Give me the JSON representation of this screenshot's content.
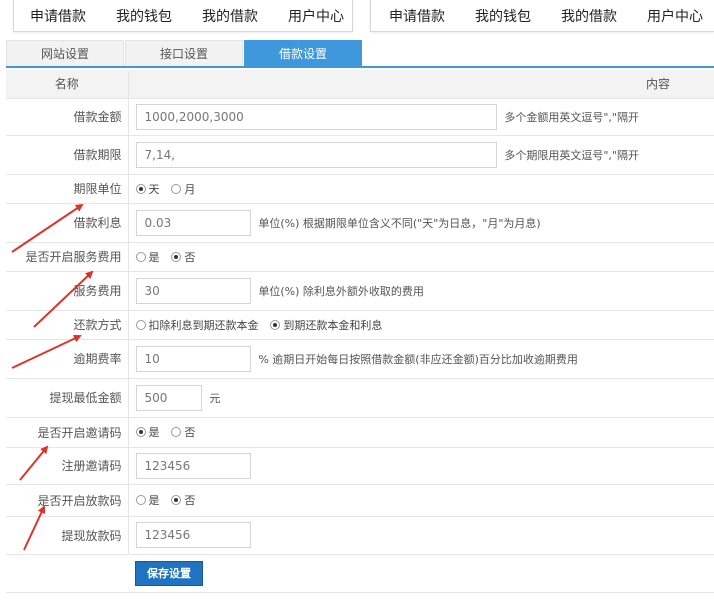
{
  "nav": {
    "left": [
      "申请借款",
      "我的钱包",
      "我的借款",
      "用户中心"
    ],
    "right": [
      "申请借款",
      "我的钱包",
      "我的借款",
      "用户中心"
    ]
  },
  "tabs": [
    {
      "label": "网站设置",
      "active": false
    },
    {
      "label": "接口设置",
      "active": false
    },
    {
      "label": "借款设置",
      "active": true
    }
  ],
  "table_header": {
    "name": "名称",
    "content": "内容"
  },
  "fields": {
    "amount": {
      "label": "借款金额",
      "value": "1000,2000,3000",
      "hint": "多个金额用英文逗号\",\"隔开"
    },
    "term": {
      "label": "借款期限",
      "value": "7,14,",
      "hint": "多个期限用英文逗号\",\"隔开"
    },
    "term_unit": {
      "label": "期限单位",
      "options": [
        "天",
        "月"
      ],
      "selected": 0
    },
    "interest": {
      "label": "借款利息",
      "value": "0.03",
      "hint": "单位(%) 根据期限单位含义不同(\"天\"为日息，\"月\"为月息)"
    },
    "service_fee_enabled": {
      "label": "是否开启服务费用",
      "options": [
        "是",
        "否"
      ],
      "selected": 1
    },
    "service_fee": {
      "label": "服务费用",
      "value": "30",
      "hint": "单位(%) 除利息外额外收取的费用"
    },
    "repayment": {
      "label": "还款方式",
      "options": [
        "扣除利息到期还款本金",
        "到期还款本金和利息"
      ],
      "selected": 1
    },
    "overdue_rate": {
      "label": "逾期费率",
      "value": "10",
      "hint": "% 逾期日开始每日按照借款金额(非应还金额)百分比加收逾期费用"
    },
    "min_withdraw": {
      "label": "提现最低金额",
      "value": "500",
      "unit": "元"
    },
    "invite_enabled": {
      "label": "是否开启邀请码",
      "options": [
        "是",
        "否"
      ],
      "selected": 0
    },
    "invite_code": {
      "label": "注册邀请码",
      "value": "123456"
    },
    "loan_code_enabled": {
      "label": "是否开启放款码",
      "options": [
        "是",
        "否"
      ],
      "selected": 1
    },
    "loan_code": {
      "label": "提现放款码",
      "value": "123456"
    }
  },
  "save_label": "保存设置",
  "colors": {
    "accent": "#3f97dc",
    "button": "#1f73c0",
    "annotation_arrow": "#d9362b"
  }
}
